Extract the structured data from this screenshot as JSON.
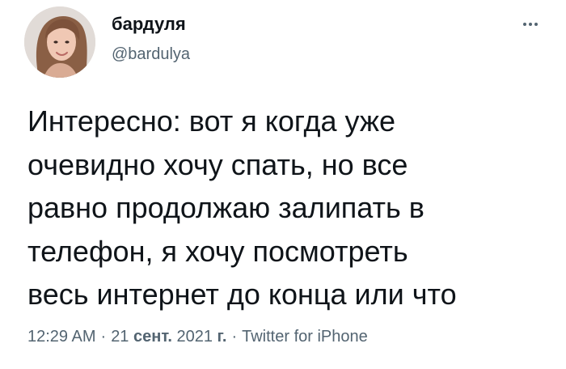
{
  "author": {
    "display_name": "бардуля",
    "handle": "@bardulya"
  },
  "tweet": {
    "text": "Интересно: вот я когда уже\nочевидно хочу спать, но все\nравно продолжаю залипать в\nтелефон, я хочу посмотреть\nвесь интернет до конца или что"
  },
  "meta": {
    "time": "12:29 AM",
    "separator_1": "·",
    "date_day": "21",
    "date_month": "сент.",
    "date_year": "2021",
    "date_suffix": "г.",
    "separator_2": "·",
    "source": "Twitter for iPhone"
  },
  "icons": {
    "more": "more-horizontal-icon",
    "avatar": "profile-photo"
  },
  "colors": {
    "text_primary": "#0f1419",
    "text_secondary": "#536471",
    "background": "#ffffff"
  }
}
